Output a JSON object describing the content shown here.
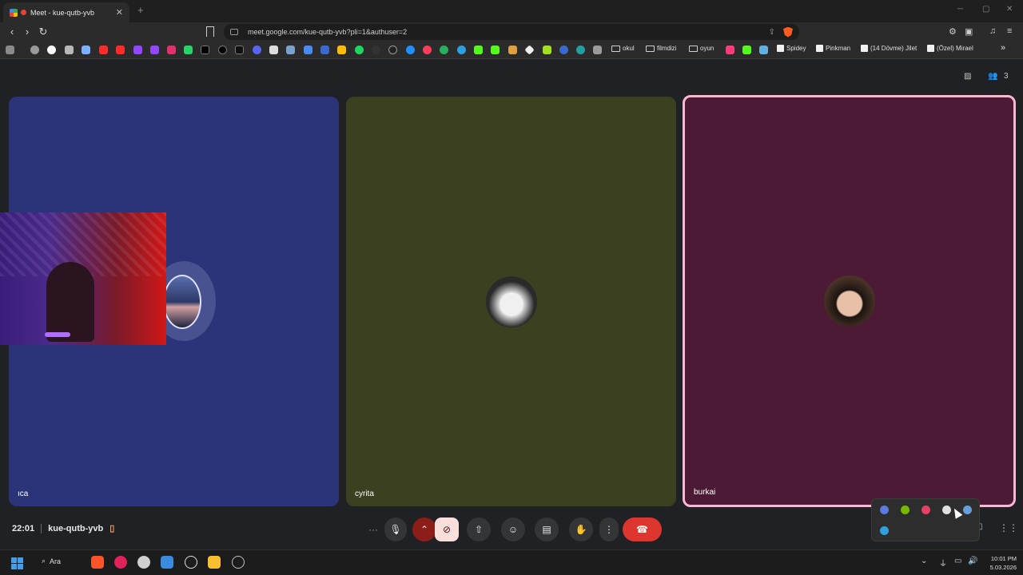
{
  "browser": {
    "tab_title": "Meet - kue-qutb-yvb",
    "new_tab": "+",
    "close": "✕",
    "url": "meet.google.com/kue-qutb-yvb?pli=1&authuser=2",
    "window_controls": [
      "─",
      "▢",
      "✕"
    ]
  },
  "bookmarks": {
    "folders": [
      "okul",
      "filmdizi",
      "oyun"
    ],
    "pages": [
      "Spidey",
      "Pinkman",
      "(14 Dövme) Jilet",
      "(Özel) Mirael"
    ],
    "overflow": "»"
  },
  "meet": {
    "participant_count": "3",
    "participants": [
      {
        "name": "ıca"
      },
      {
        "name": "cyrita"
      },
      {
        "name": "burkai"
      }
    ],
    "time": "22:01",
    "meeting_code": "kue-qutb-yvb"
  },
  "taskbar": {
    "search_label": "Ara",
    "time": "10:01 PM",
    "date": "5.03.2026"
  },
  "colors": {
    "tile_ica": "#2b3478",
    "tile_cyrita": "#3b4020",
    "tile_burkai": "#4d1a35",
    "active_speaker_border": "#f8b8d4",
    "end_call": "#dc362e"
  }
}
